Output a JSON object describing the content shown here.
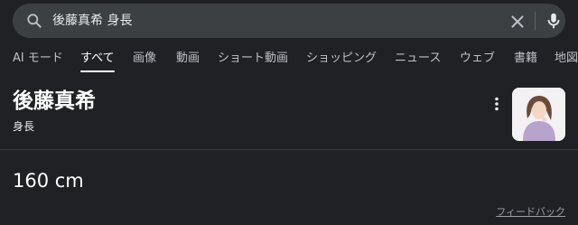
{
  "search": {
    "query": "後藤真希 身長",
    "icons": {
      "search": "search-icon",
      "clear": "close-icon",
      "mic": "microphone-icon"
    }
  },
  "tabs": [
    {
      "label": "AI モード",
      "active": false
    },
    {
      "label": "すべて",
      "active": true
    },
    {
      "label": "画像",
      "active": false
    },
    {
      "label": "動画",
      "active": false
    },
    {
      "label": "ショート動画",
      "active": false
    },
    {
      "label": "ショッピング",
      "active": false
    },
    {
      "label": "ニュース",
      "active": false
    },
    {
      "label": "ウェブ",
      "active": false
    },
    {
      "label": "書籍",
      "active": false
    },
    {
      "label": "地図",
      "active": false
    }
  ],
  "entity": {
    "name": "後藤真希",
    "attribute": "身長",
    "more_icon": "more-vert-icon",
    "thumbnail": "person-photo"
  },
  "answer": {
    "value": "160 cm"
  },
  "footer": {
    "feedback": "フィードバック"
  },
  "colors": {
    "background": "#202124",
    "search_bar": "#3c4043",
    "text": "#e8eaed",
    "muted": "#9aa0a6"
  }
}
